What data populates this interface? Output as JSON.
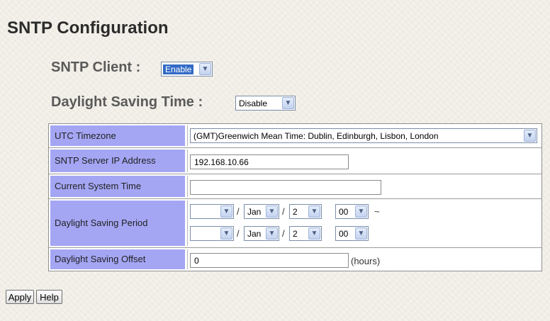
{
  "page": {
    "title": "SNTP Configuration"
  },
  "sntp_client": {
    "label": "SNTP Client :",
    "value": "Enable"
  },
  "dst": {
    "label": "Daylight Saving Time :",
    "value": "Disable"
  },
  "table": {
    "utc_timezone": {
      "label": "UTC Timezone",
      "value": "(GMT)Greenwich Mean Time: Dublin, Edinburgh, Lisbon, London"
    },
    "server_ip": {
      "label": "SNTP Server IP Address",
      "value": "192.168.10.66"
    },
    "current_time": {
      "label": "Current System Time",
      "value": ""
    },
    "dst_period": {
      "label": "Daylight Saving Period",
      "separator": "/",
      "tilde": "~",
      "start": {
        "year": "",
        "month": "Jan",
        "day": "2",
        "hour": "00"
      },
      "end": {
        "year": "",
        "month": "Jan",
        "day": "2",
        "hour": "00"
      }
    },
    "dst_offset": {
      "label": "Daylight Saving Offset",
      "value": "0",
      "unit": "(hours)"
    }
  },
  "buttons": {
    "apply": "Apply",
    "help": "Help"
  },
  "icons": {
    "dropdown": "chevron-down-icon"
  }
}
